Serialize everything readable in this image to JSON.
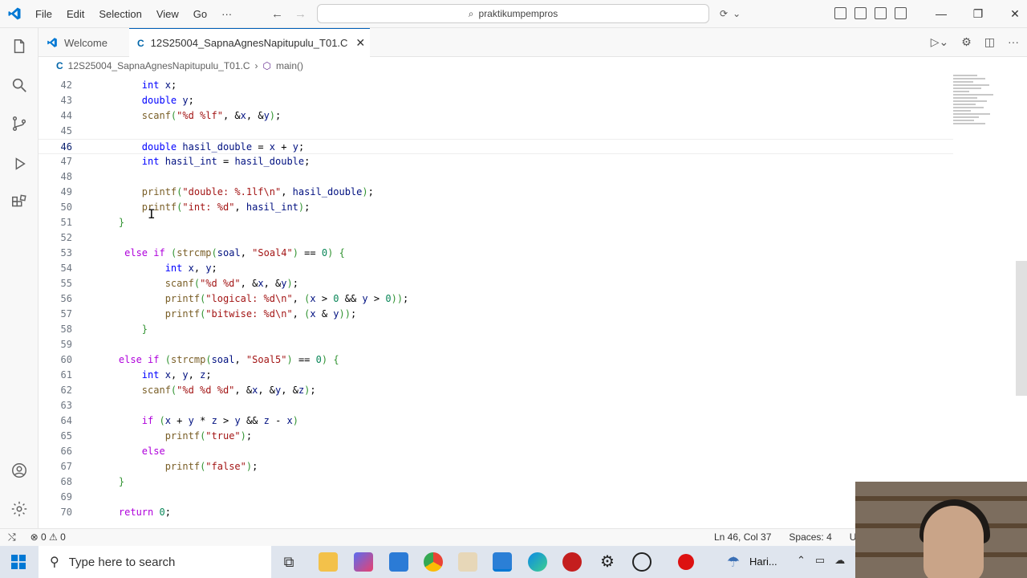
{
  "titlebar": {
    "menu": [
      "File",
      "Edit",
      "Selection",
      "View",
      "Go",
      "···"
    ],
    "search_text": "praktikumpempros",
    "window_controls": [
      "—",
      "❐",
      "✕"
    ]
  },
  "tabs": [
    {
      "label": "Welcome"
    },
    {
      "label": "12S25004_SapnaAgnesNapitupulu_T01.C"
    }
  ],
  "breadcrumb": {
    "file": "12S25004_SapnaAgnesNapitupulu_T01.C",
    "symbol": "main()"
  },
  "code_lines": [
    {
      "n": "42",
      "t": "        int x;"
    },
    {
      "n": "43",
      "t": "        double y;"
    },
    {
      "n": "44",
      "t": "        scanf(\"%d %lf\", &x, &y);"
    },
    {
      "n": "45",
      "t": ""
    },
    {
      "n": "46",
      "t": "        double hasil_double = x + y;"
    },
    {
      "n": "47",
      "t": "        int hasil_int = hasil_double;"
    },
    {
      "n": "48",
      "t": ""
    },
    {
      "n": "49",
      "t": "        printf(\"double: %.1lf\\n\", hasil_double);"
    },
    {
      "n": "50",
      "t": "        printf(\"int: %d\", hasil_int);"
    },
    {
      "n": "51",
      "t": "    }"
    },
    {
      "n": "52",
      "t": ""
    },
    {
      "n": "53",
      "t": "     else if (strcmp(soal, \"Soal4\") == 0) {"
    },
    {
      "n": "54",
      "t": "            int x, y;"
    },
    {
      "n": "55",
      "t": "            scanf(\"%d %d\", &x, &y);"
    },
    {
      "n": "56",
      "t": "            printf(\"logical: %d\\n\", (x > 0 && y > 0));"
    },
    {
      "n": "57",
      "t": "            printf(\"bitwise: %d\\n\", (x & y));"
    },
    {
      "n": "58",
      "t": "        }"
    },
    {
      "n": "59",
      "t": ""
    },
    {
      "n": "60",
      "t": "    else if (strcmp(soal, \"Soal5\") == 0) {"
    },
    {
      "n": "61",
      "t": "        int x, y, z;"
    },
    {
      "n": "62",
      "t": "        scanf(\"%d %d %d\", &x, &y, &z);"
    },
    {
      "n": "63",
      "t": ""
    },
    {
      "n": "64",
      "t": "        if (x + y * z > y && z - x)"
    },
    {
      "n": "65",
      "t": "            printf(\"true\");"
    },
    {
      "n": "66",
      "t": "        else"
    },
    {
      "n": "67",
      "t": "            printf(\"false\");"
    },
    {
      "n": "68",
      "t": "    }"
    },
    {
      "n": "69",
      "t": ""
    },
    {
      "n": "70",
      "t": "    return 0;"
    }
  ],
  "statusbar": {
    "problems": "⊗ 0 ⚠ 0",
    "cursor": "Ln 46, Col 37",
    "spaces": "Spaces: 4",
    "encoding": "UTF-"
  },
  "taskbar": {
    "search_placeholder": "Type here to search",
    "weather_text": "Hari..."
  },
  "colors": {
    "accent": "#005fb8",
    "keyword": "#0000ff",
    "control": "#af00db",
    "function": "#795e26",
    "string": "#a31515"
  }
}
